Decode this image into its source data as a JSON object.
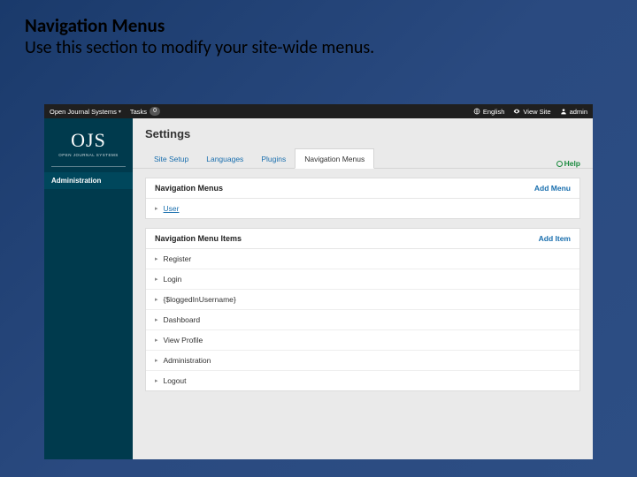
{
  "slide": {
    "title": "Navigation Menus",
    "subtitle": "Use this section to modify your site-wide menus."
  },
  "topbar": {
    "app_name": "Open Journal Systems",
    "tasks_label": "Tasks",
    "tasks_count": "0",
    "lang": "English",
    "view_site": "View Site",
    "user": "admin"
  },
  "sidebar": {
    "logo_main": "OJS",
    "logo_sub": "OPEN JOURNAL SYSTEMS",
    "items": [
      "Administration"
    ]
  },
  "page": {
    "title": "Settings",
    "tabs": [
      "Site Setup",
      "Languages",
      "Plugins",
      "Navigation Menus"
    ],
    "active_tab_index": 3,
    "help_label": "Help"
  },
  "menus_panel": {
    "title": "Navigation Menus",
    "action": "Add Menu",
    "rows": [
      "User"
    ]
  },
  "items_panel": {
    "title": "Navigation Menu Items",
    "action": "Add Item",
    "rows": [
      "Register",
      "Login",
      "{$loggedInUsername}",
      "Dashboard",
      "View Profile",
      "Administration",
      "Logout"
    ]
  }
}
